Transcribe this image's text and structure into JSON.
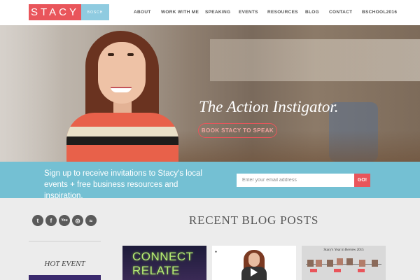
{
  "logo": {
    "name": "STACY",
    "subtitle": "BOSCH"
  },
  "nav": {
    "items": [
      "ABOUT",
      "WORK WITH ME",
      "SPEAKING",
      "EVENTS",
      "RESOURCES",
      "BLOG",
      "CONTACT",
      "BSCHOOL2016"
    ]
  },
  "hero": {
    "tagline": "The Action Instigator.",
    "cta_label": "BOOK STACY TO SPEAK"
  },
  "signup": {
    "text": "Sign up to receive invitations to Stacy's local events + free business resources and inspiration.",
    "email_placeholder": "Enter your email address",
    "submit_label": "GO!"
  },
  "social": {
    "icons": [
      "twitter-icon",
      "facebook-icon",
      "youtube-icon",
      "instagram-icon",
      "rss-icon"
    ],
    "glyphs": [
      "t",
      "f",
      "You",
      "◎",
      "≈"
    ]
  },
  "sidebar": {
    "hot_event_label": "HOT EVENT"
  },
  "blog": {
    "section_title": "RECENT BLOG POSTS",
    "post1_lines": [
      "CONNECT",
      "RELATE"
    ],
    "post3_title": "Stacy's Year in Review 2015"
  },
  "colors": {
    "brand_coral": "#e9555b",
    "brand_blue": "#8fcbe0",
    "signup_band": "#74c0d3",
    "lower_bg": "#ececec"
  }
}
